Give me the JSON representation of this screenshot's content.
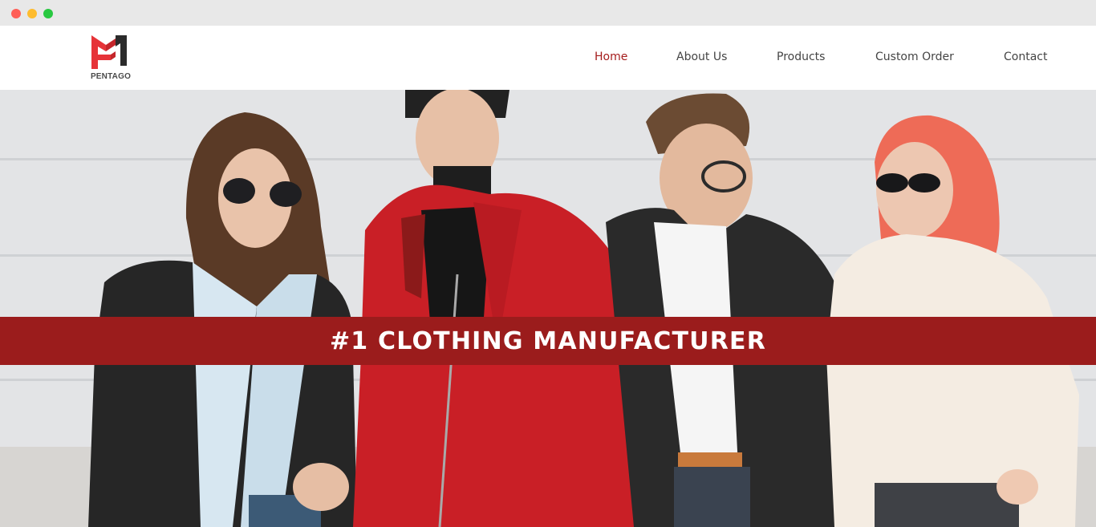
{
  "window": {
    "controls": [
      "close",
      "minimize",
      "maximize"
    ]
  },
  "brand": {
    "name": "PENTAGO",
    "primary_color": "#e63338",
    "secondary_color": "#2b2b2b"
  },
  "nav": {
    "items": [
      {
        "label": "Home",
        "active": true
      },
      {
        "label": "About Us",
        "active": false
      },
      {
        "label": "Products",
        "active": false
      },
      {
        "label": "Custom Order",
        "active": false
      },
      {
        "label": "Contact",
        "active": false
      }
    ],
    "active_color": "#a51c1c",
    "text_color": "#444444"
  },
  "hero": {
    "headline": "#1 CLOTHING MANUFACTURER",
    "banner_color": "#9b1c1c",
    "image_subject": "four-models-in-jackets-photo"
  }
}
